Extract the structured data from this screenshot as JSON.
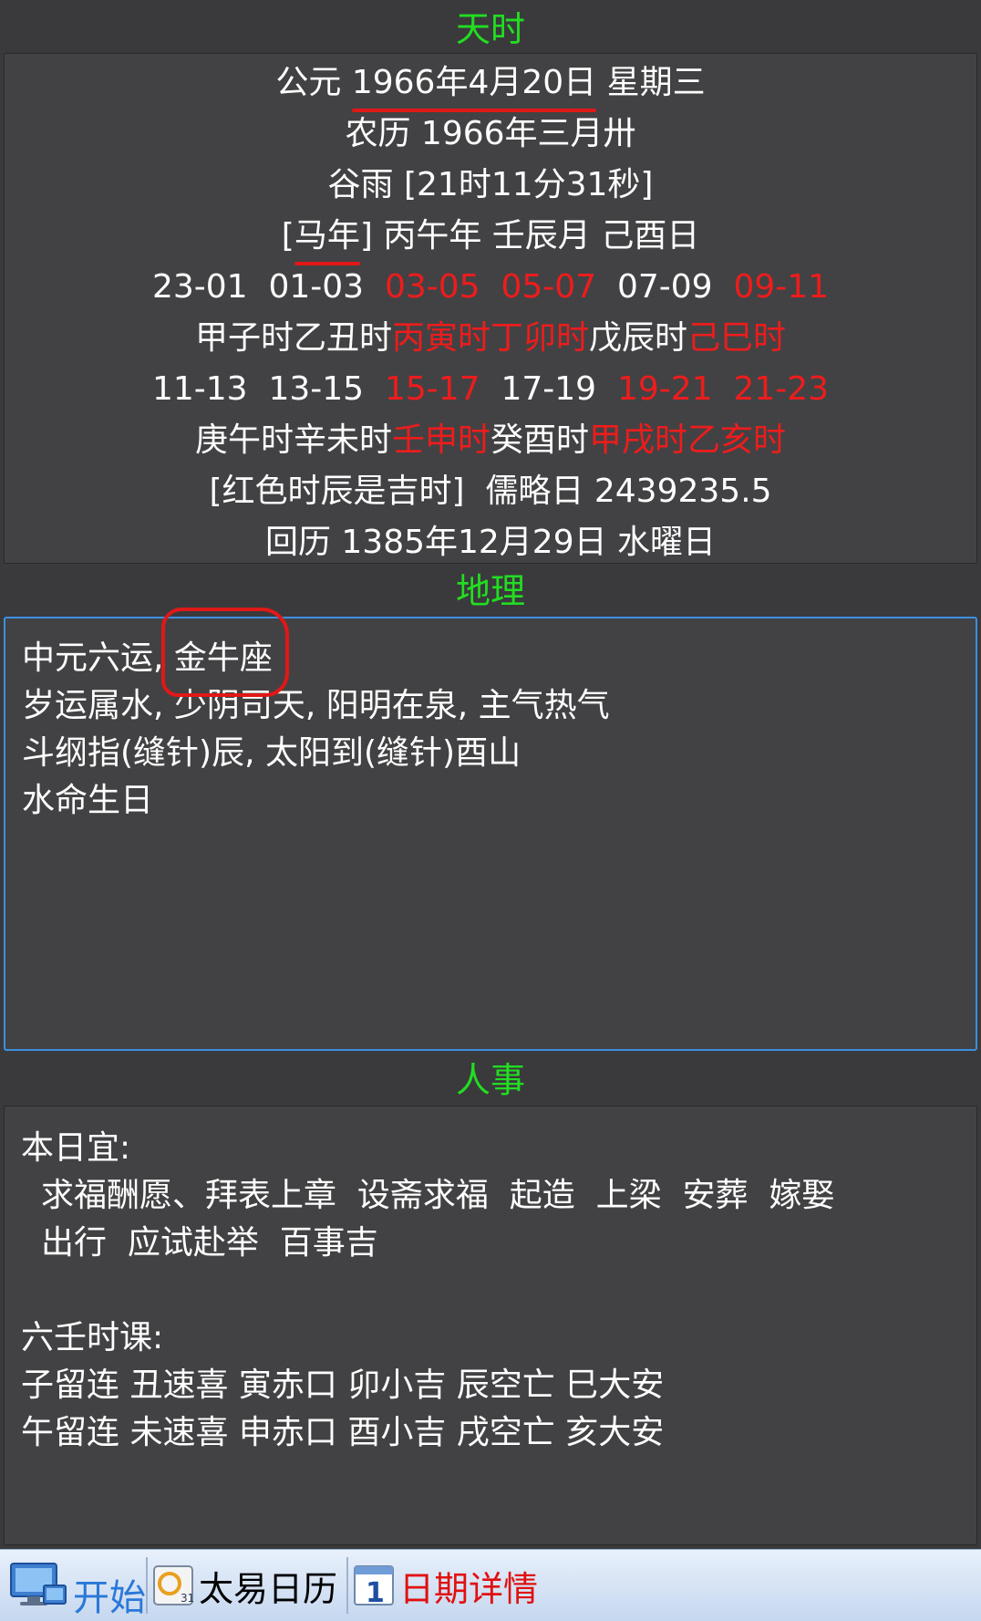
{
  "tianshi": {
    "title": "天时",
    "gregorian_prefix": "公元 ",
    "gregorian_date": "1966年4月20日",
    "gregorian_weekday": " 星期三",
    "lunar": "农历 1966年三月卅",
    "solar_term": "谷雨 [21时11分31秒]",
    "zodiac_open": "[",
    "zodiac": "马年",
    "zodiac_rest": "] 丙午年 壬辰月 己酉日",
    "hours_row1": [
      "23-01",
      "01-03",
      "03-05",
      "05-07",
      "07-09",
      "09-11"
    ],
    "shichen_row1": [
      "甲子时",
      "乙丑时",
      "丙寅时",
      "丁卯时",
      "戊辰时",
      "己巳时"
    ],
    "hours_row2": [
      "11-13",
      "13-15",
      "15-17",
      "17-19",
      "19-21",
      "21-23"
    ],
    "shichen_row2": [
      "庚午时",
      "辛未时",
      "壬申时",
      "癸酉时",
      "甲戌时",
      "乙亥时"
    ],
    "auspicious_row1": [
      false,
      false,
      true,
      true,
      false,
      true
    ],
    "auspicious_row2": [
      false,
      false,
      true,
      false,
      true,
      true
    ],
    "note": "[红色时辰是吉时]  儒略日 2439235.5",
    "hijri": "回历 1385年12月29日 水曜日"
  },
  "dili": {
    "title": "地理",
    "line1_prefix": "中元六运, ",
    "constellation": "金牛座",
    "line2": "岁运属水, 少阴司天, 阳明在泉, 主气热气",
    "line3": "斗纲指(缝针)辰, 太阳到(缝针)酉山",
    "line4": "水命生日"
  },
  "renshi": {
    "title": "人事",
    "yi_label": "本日宜:",
    "yi_line1": "求福酬愿、拜表上章  设斋求福  起造  上梁  安葬  嫁娶",
    "yi_line2": "出行  应试赴举  百事吉",
    "liuren_label": "六壬时课:",
    "liuren_line1": "子留连 丑速喜 寅赤口 卯小吉 辰空亡 巳大安",
    "liuren_line2": "午留连 未速喜 申赤口 酉小吉 戌空亡 亥大安"
  },
  "taskbar": {
    "start": "开始",
    "app1": "太易日历",
    "app1_icon_text": "31",
    "app2": "日期详情",
    "app2_icon_text": "1"
  },
  "colors": {
    "section_title": "#22dd22",
    "auspicious": "#ee1c1c",
    "annotation": "#e01818",
    "background": "#3a3a3c"
  }
}
